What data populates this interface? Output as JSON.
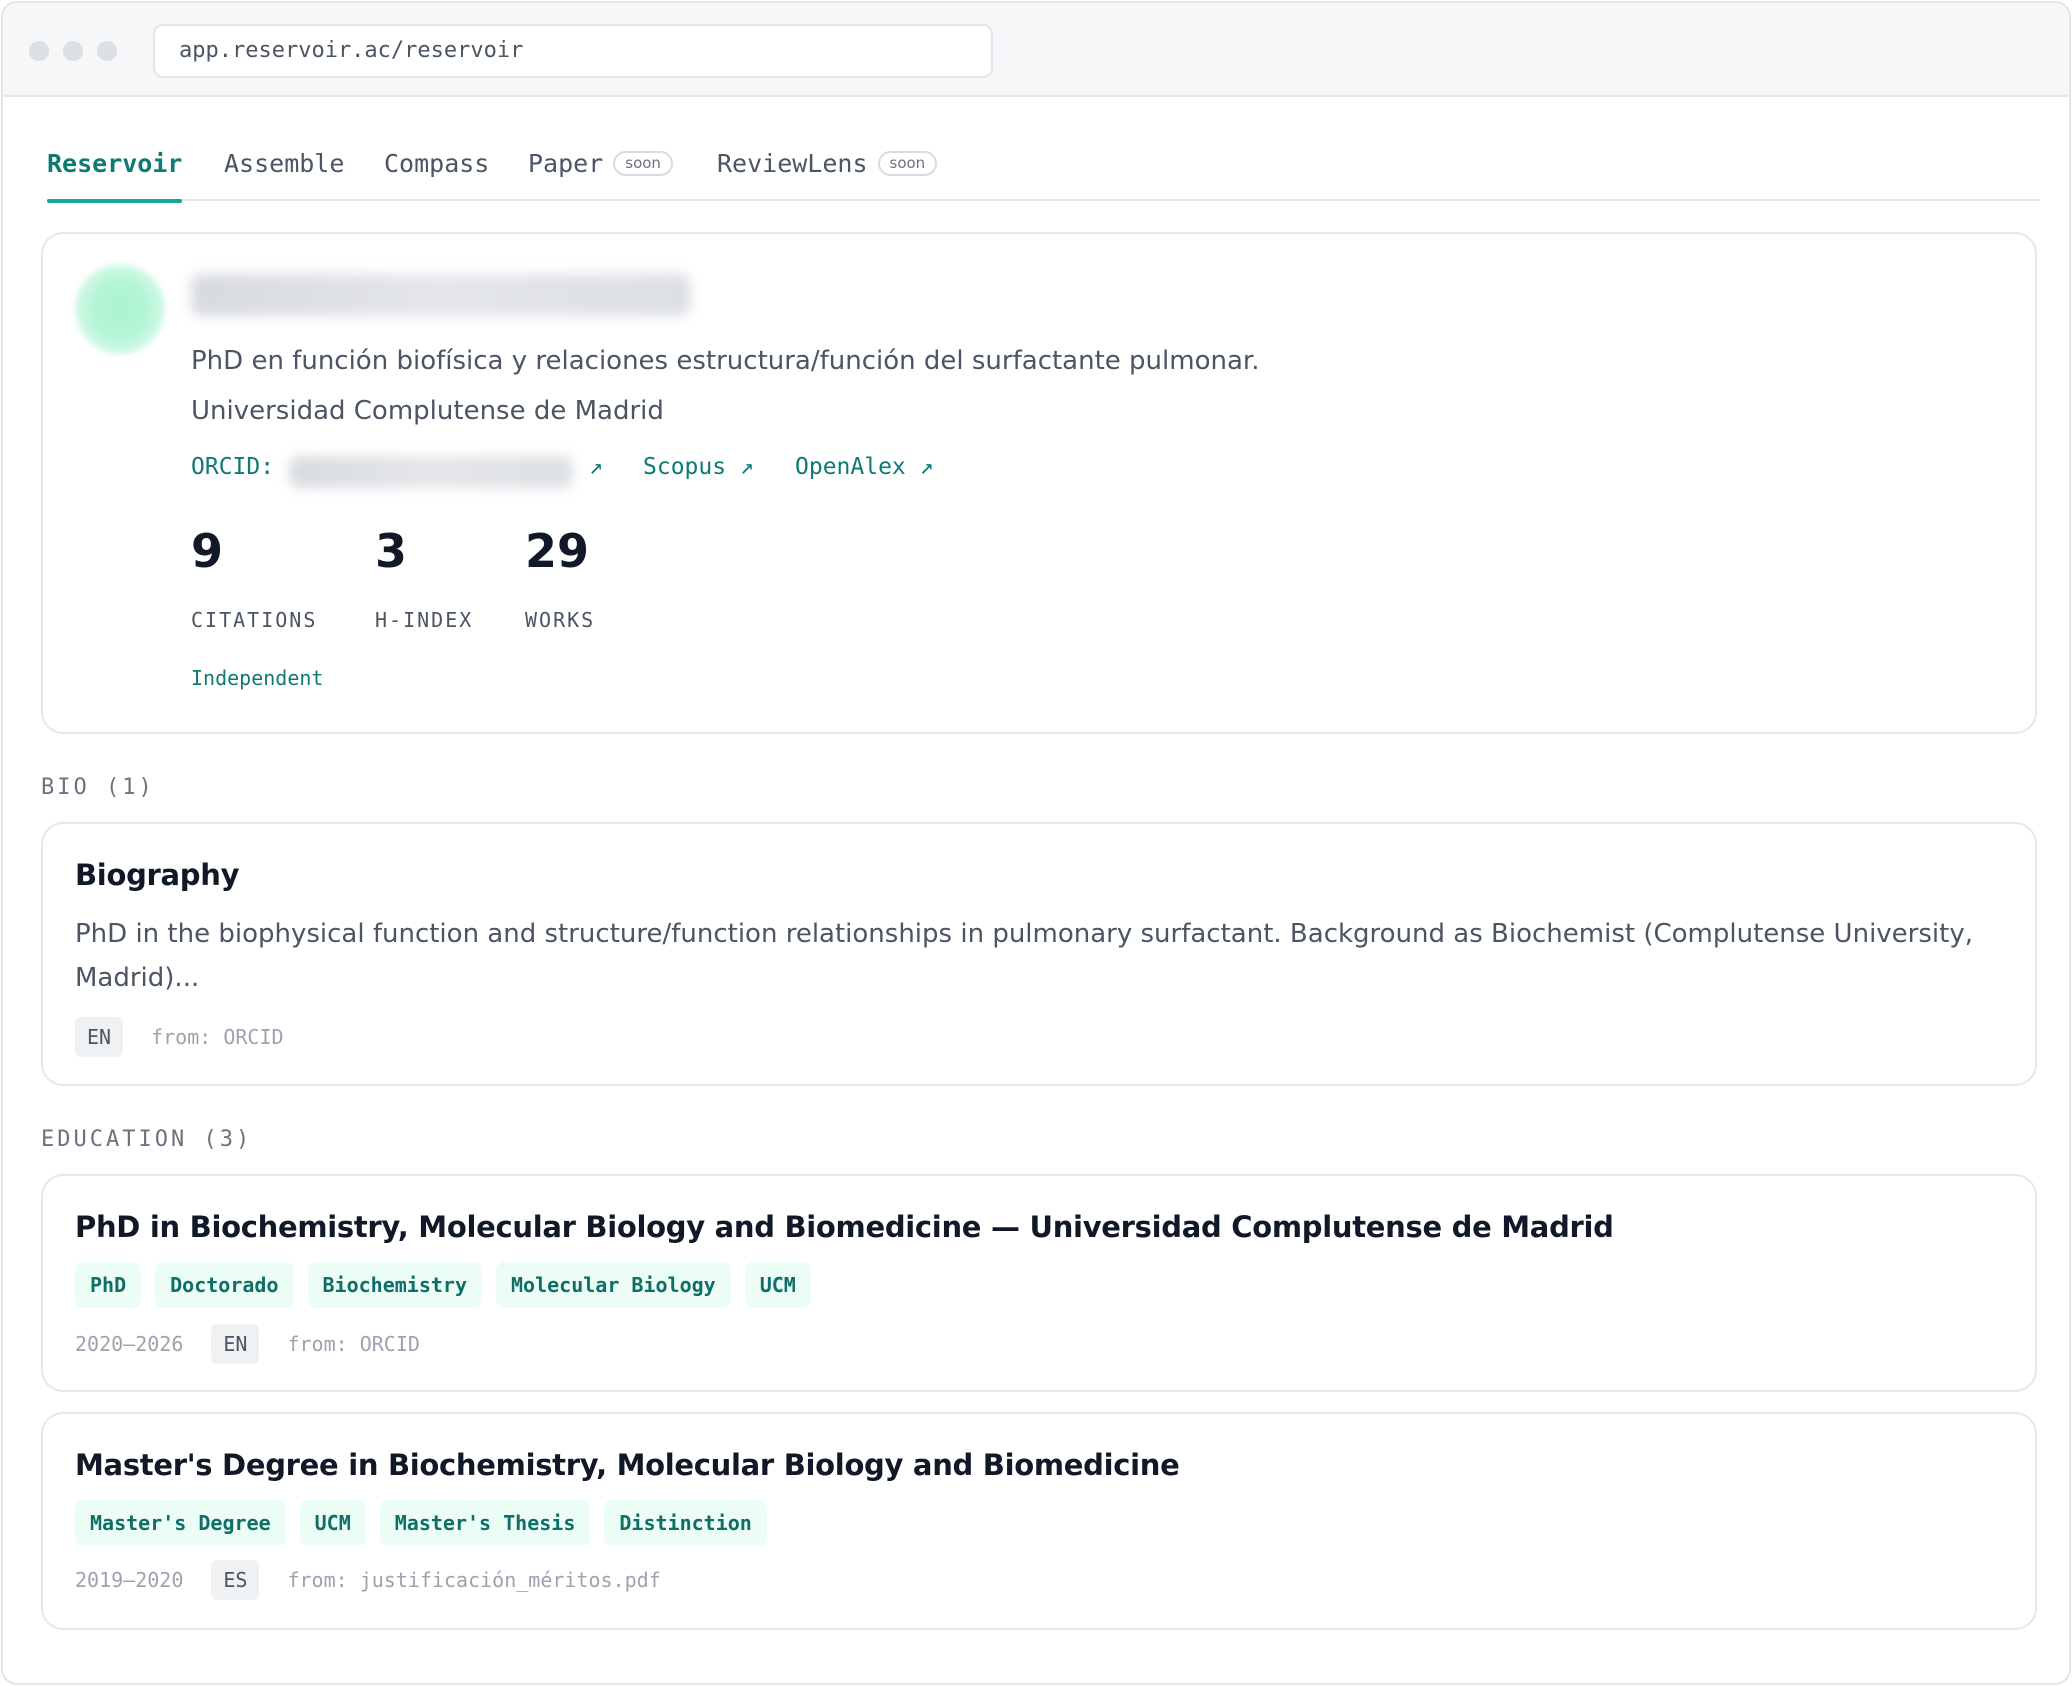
{
  "browser": {
    "url": "app.reservoir.ac/reservoir"
  },
  "tabs": [
    {
      "label": "Reservoir",
      "badge": ""
    },
    {
      "label": "Assemble",
      "badge": ""
    },
    {
      "label": "Compass",
      "badge": ""
    },
    {
      "label": "Paper",
      "badge": "soon"
    },
    {
      "label": "ReviewLens",
      "badge": "soon"
    }
  ],
  "profile": {
    "description": "PhD en función biofísica y relaciones estructura/función del surfactante pulmonar.",
    "institution": "Universidad Complutense de Madrid",
    "orcid_label": "ORCID:",
    "orcid_arrow": "↗",
    "scopus_link": "Scopus ↗",
    "openalex_link": "OpenAlex ↗",
    "stats": [
      {
        "value": "9",
        "label": "CITATIONS"
      },
      {
        "value": "3",
        "label": "H-INDEX"
      },
      {
        "value": "29",
        "label": "WORKS"
      }
    ],
    "affiliation_status": "Independent"
  },
  "bio": {
    "section_label": "BIO (1)",
    "title": "Biography",
    "text": "PhD in the biophysical function and structure/function relationships in pulmonary surfactant. Background as Biochemist (Complutense University, Madrid)...",
    "lang": "EN",
    "source": "from: ORCID"
  },
  "education": {
    "section_label": "EDUCATION (3)",
    "items": [
      {
        "title": "PhD in Biochemistry, Molecular Biology and Biomedicine — Universidad Complutense de Madrid",
        "tags": [
          "PhD",
          "Doctorado",
          "Biochemistry",
          "Molecular Biology",
          "UCM"
        ],
        "dates": "2020–2026",
        "lang": "EN",
        "source": "from: ORCID"
      },
      {
        "title": "Master's Degree in Biochemistry, Molecular Biology and Biomedicine",
        "tags": [
          "Master's Degree",
          "UCM",
          "Master's Thesis",
          "Distinction"
        ],
        "dates": "2019–2020",
        "lang": "ES",
        "source": "from: justificación_méritos.pdf"
      }
    ]
  },
  "colors": {
    "accent": "#0f7a74",
    "tab_underline": "#14a897",
    "tag_bg": "#ecfdf5"
  }
}
